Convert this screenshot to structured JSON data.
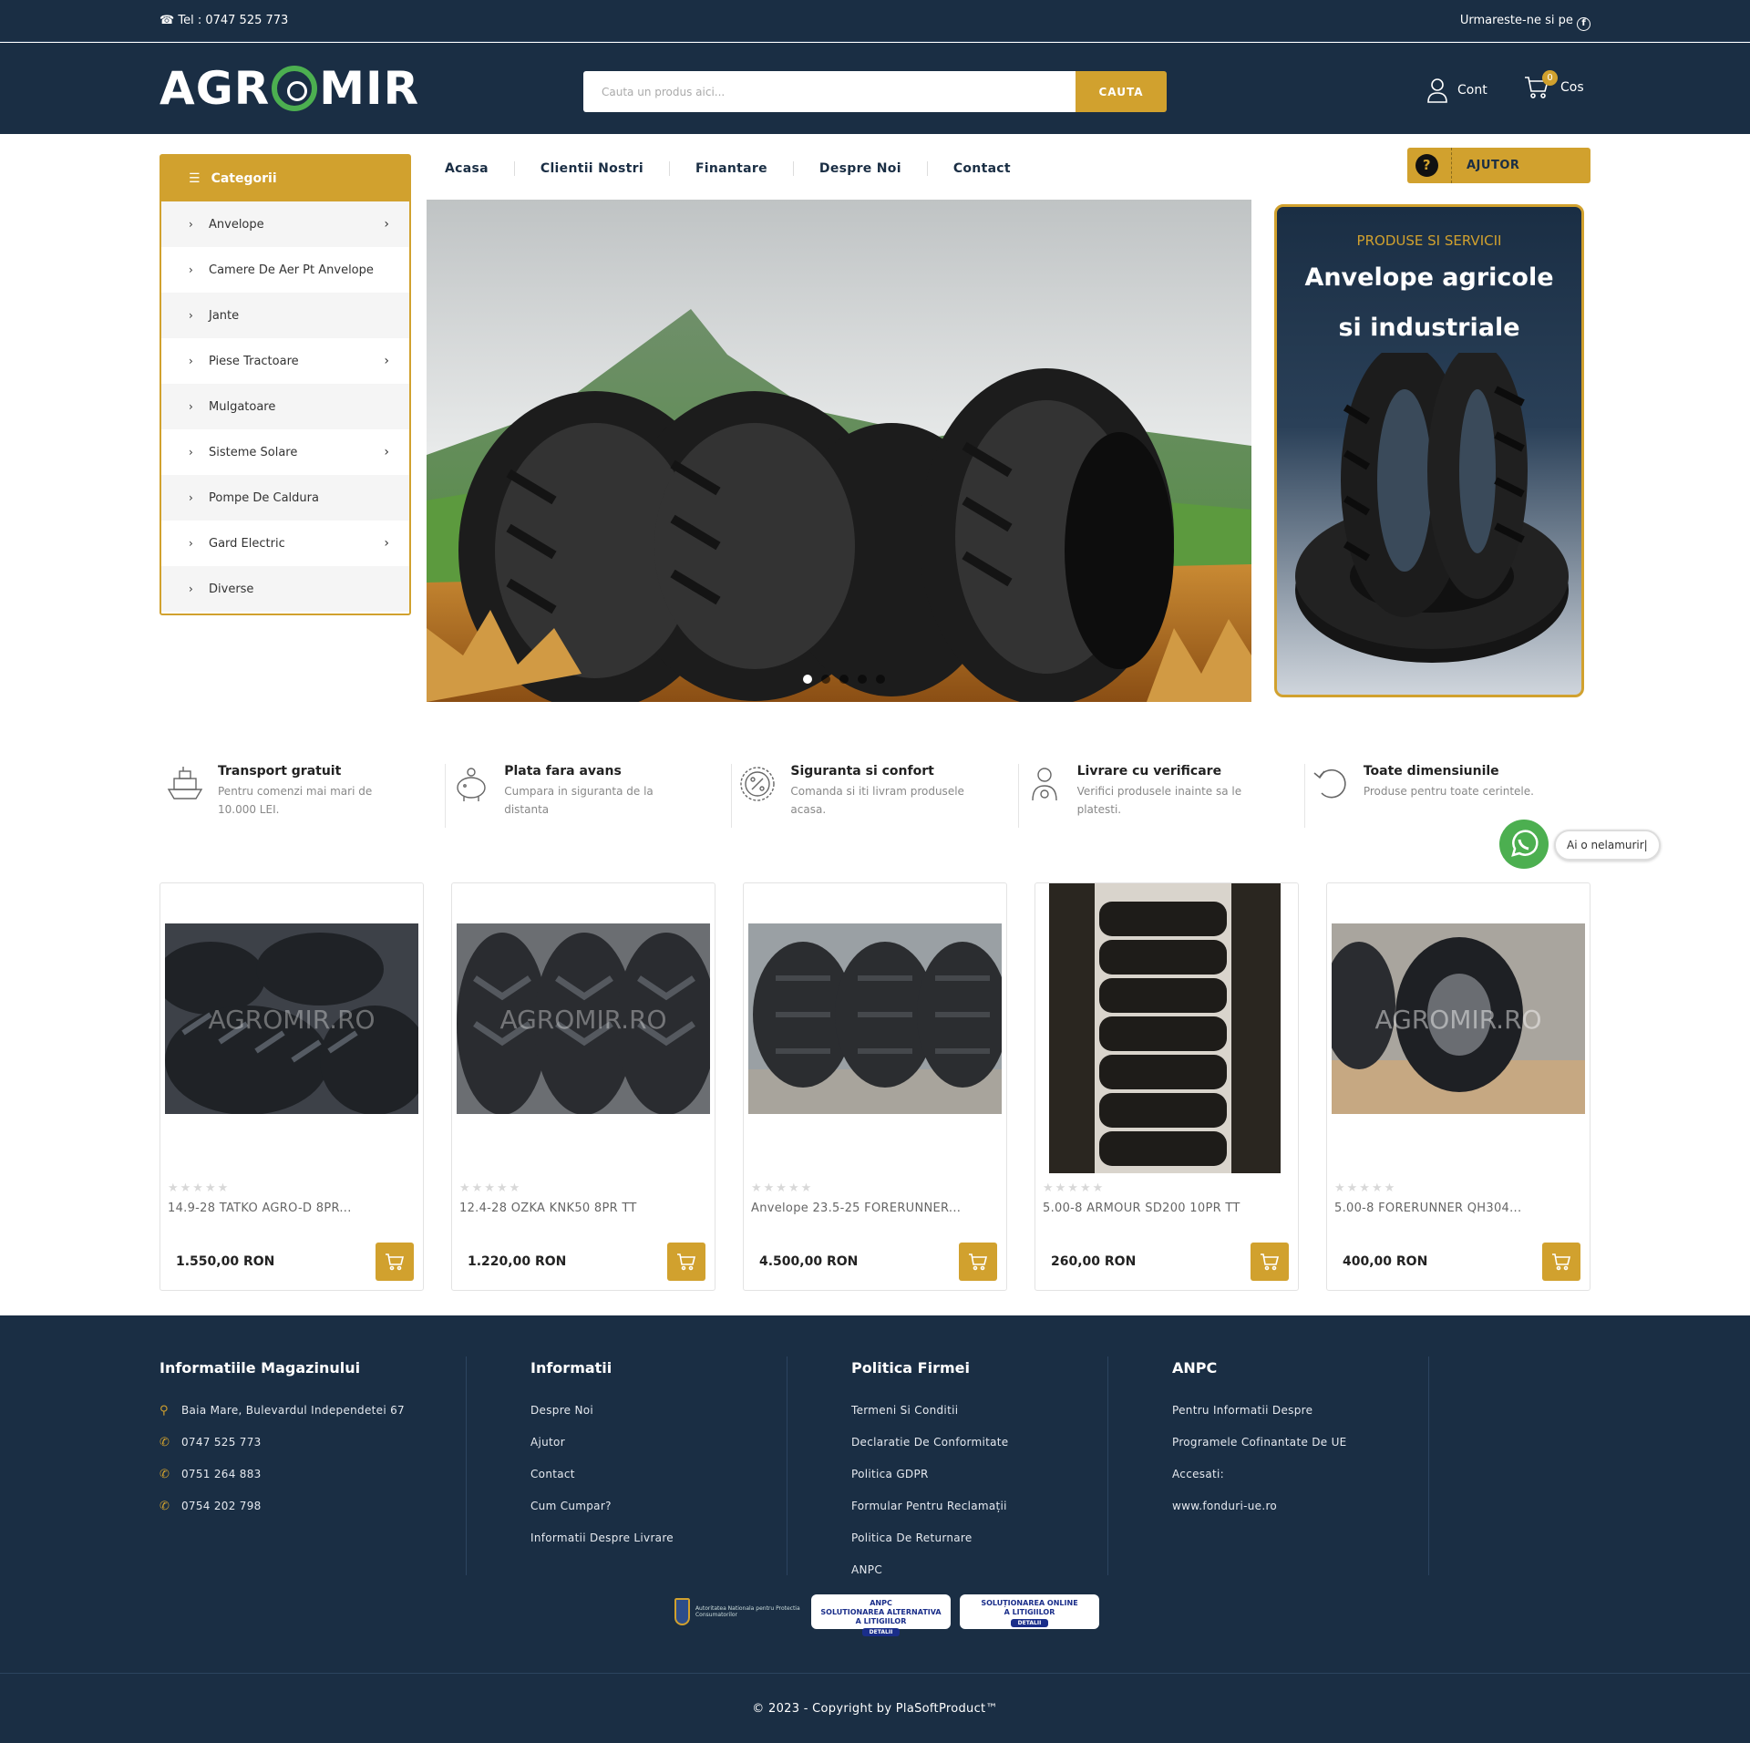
{
  "topbar": {
    "phone": "Tel : 0747 525 773",
    "follow": "Urmareste-ne si pe"
  },
  "header": {
    "logo_left": "AGR",
    "logo_right": "MIR",
    "search_placeholder": "Cauta un produs aici...",
    "search_button": "CAUTA",
    "account_label": "Cont",
    "cart_label": "Cos",
    "cart_count": "0"
  },
  "sidebar": {
    "title": "Categorii",
    "items": [
      {
        "label": "Anvelope",
        "has_sub": true
      },
      {
        "label": "Camere De Aer Pt Anvelope",
        "has_sub": false
      },
      {
        "label": "Jante",
        "has_sub": false
      },
      {
        "label": "Piese Tractoare",
        "has_sub": true
      },
      {
        "label": "Mulgatoare",
        "has_sub": false
      },
      {
        "label": "Sisteme Solare",
        "has_sub": true
      },
      {
        "label": "Pompe De Caldura",
        "has_sub": false
      },
      {
        "label": "Gard Electric",
        "has_sub": true
      },
      {
        "label": "Diverse",
        "has_sub": false
      }
    ]
  },
  "nav": {
    "items": [
      "Acasa",
      "Clientii Nostri",
      "Finantare",
      "Despre Noi",
      "Contact"
    ],
    "help_label": "AJUTOR"
  },
  "slider": {
    "active_slide": 1,
    "slide_count": 5
  },
  "promo": {
    "kicker": "PRODUSE SI SERVICII",
    "title_line1": "Anvelope agricole",
    "title_line2": "si industriale"
  },
  "features": [
    {
      "title": "Transport gratuit",
      "desc": "Pentru comenzi mai mari de 10.000 LEI.",
      "icon": "ship-icon"
    },
    {
      "title": "Plata fara avans",
      "desc": "Cumpara in siguranta de la distanta",
      "icon": "piggy-bank-icon"
    },
    {
      "title": "Siguranta si confort",
      "desc": "Comanda si iti livram produsele acasa.",
      "icon": "percent-badge-icon"
    },
    {
      "title": "Livrare cu verificare",
      "desc": "Verifici produsele inainte sa le platesti.",
      "icon": "delivery-person-icon"
    },
    {
      "title": "Toate dimensiunile",
      "desc": "Produse pentru toate cerintele.",
      "icon": "undo-arrow-icon"
    }
  ],
  "whatsapp": {
    "bubble_text": "Ai o nelamurir|"
  },
  "products": [
    {
      "name": "14.9-28 TATKO AGRO-D 8PR...",
      "price": "1.550,00 RON",
      "watermark": "AGROMIR.RO",
      "rating": 0
    },
    {
      "name": "12.4-28 OZKA KNK50 8PR TT",
      "price": "1.220,00 RON",
      "watermark": "AGROMIR.RO",
      "rating": 0
    },
    {
      "name": "Anvelope 23.5-25 FORERUNNER...",
      "price": "4.500,00 RON",
      "watermark": "",
      "rating": 0
    },
    {
      "name": "5.00-8 ARMOUR SD200 10PR TT",
      "price": "260,00 RON",
      "watermark": "",
      "rating": 0
    },
    {
      "name": "5.00-8 FORERUNNER QH304...",
      "price": "400,00 RON",
      "watermark": "AGROMIR.RO",
      "rating": 0
    }
  ],
  "footer": {
    "col1": {
      "title": "Informatiile Magazinului",
      "lines": [
        "Baia Mare, Bulevardul Independetei 67",
        "0747 525 773",
        "0751 264 883",
        "0754 202 798"
      ]
    },
    "col2": {
      "title": "Informatii",
      "lines": [
        "Despre Noi",
        "Ajutor",
        "Contact",
        "Cum Cumpar?",
        "Informatii Despre Livrare"
      ]
    },
    "col3": {
      "title": "Politica Firmei",
      "lines": [
        "Termeni Si Conditii",
        "Declaratie De Conformitate",
        "Politica GDPR",
        "Formular Pentru Reclamații",
        "Politica De Returnare",
        "ANPC"
      ]
    },
    "col4": {
      "title": "ANPC",
      "lines": [
        "Pentru Informatii Despre",
        "Programele Cofinantate De UE",
        "Accesati:",
        "www.fonduri-ue.ro"
      ]
    },
    "badge1": "Autoritatea Nationala pentru Protectia Consumatorilor",
    "badge2_line1": "SOLUTIONAREA ALTERNATIVA",
    "badge2_line2": "A LITIGIILOR",
    "badge3_line1": "SOLUȚIONAREA ONLINE",
    "badge3_line2": "A LITIGIILOR",
    "badge_details": "DETALII",
    "badge2_brand": "ANPC",
    "copyright": "© 2023 - Copyright by PlaSoftProduct™"
  },
  "colors": {
    "navy": "#1a2e44",
    "gold": "#d1a12e",
    "whatsapp_green": "#4caf50"
  }
}
